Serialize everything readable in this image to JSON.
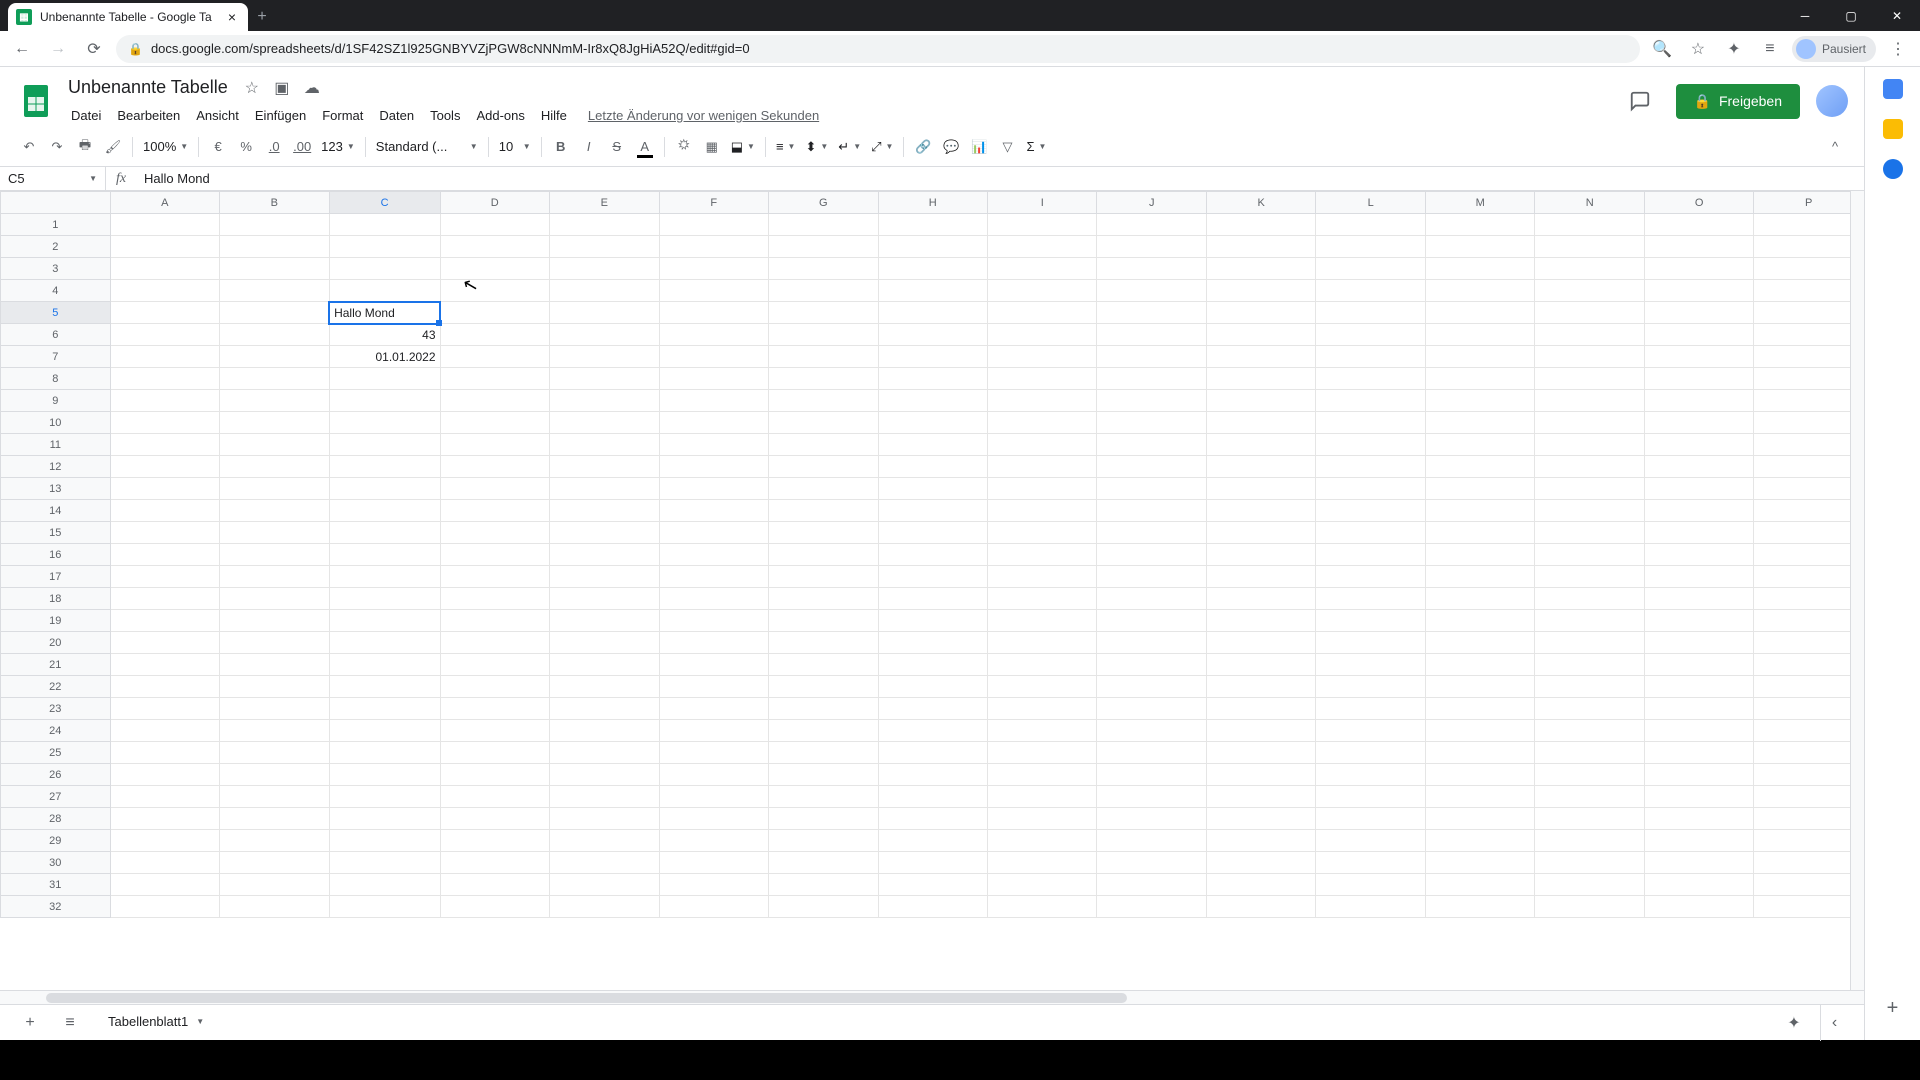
{
  "browser": {
    "tab_title": "Unbenannte Tabelle - Google Ta",
    "url": "docs.google.com/spreadsheets/d/1SF42SZ1l925GNBYVZjPGW8cNNNmM-Ir8xQ8JgHiA52Q/edit#gid=0",
    "profile_state": "Pausiert"
  },
  "doc": {
    "title": "Unbenannte Tabelle",
    "last_edit": "Letzte Änderung vor wenigen Sekunden",
    "share_label": "Freigeben"
  },
  "menu": {
    "file": "Datei",
    "edit": "Bearbeiten",
    "view": "Ansicht",
    "insert": "Einfügen",
    "format": "Format",
    "data": "Daten",
    "tools": "Tools",
    "addons": "Add-ons",
    "help": "Hilfe"
  },
  "toolbar": {
    "zoom": "100%",
    "currency": "€",
    "percent": "%",
    "dec_dec": ".0",
    "inc_dec": ".00",
    "num_format": "123",
    "font_format": "Standard (...",
    "font_size": "10"
  },
  "namebox": {
    "cell_ref": "C5"
  },
  "formula": {
    "value": "Hallo Mond"
  },
  "columns": [
    "A",
    "B",
    "C",
    "D",
    "E",
    "F",
    "G",
    "H",
    "I",
    "J",
    "K",
    "L",
    "M",
    "N",
    "O",
    "P"
  ],
  "cells": {
    "C5": "Hallo Mond",
    "C6": "43",
    "C7": "01.01.2022"
  },
  "selected": {
    "row": 5,
    "col": "C"
  },
  "sheet_tabs": {
    "name": "Tabellenblatt1"
  }
}
